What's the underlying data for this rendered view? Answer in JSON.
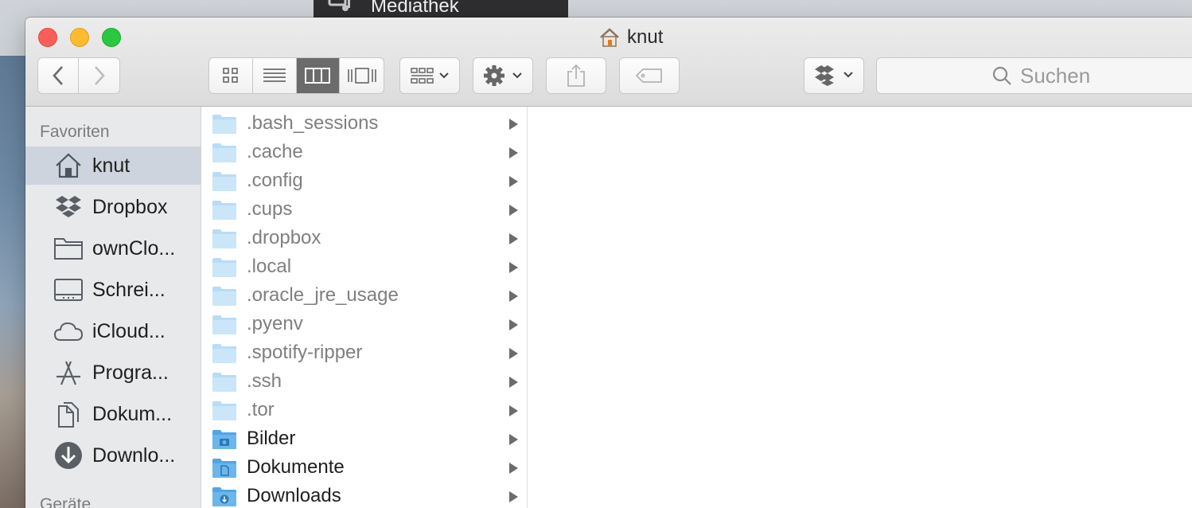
{
  "background_window": {
    "title": "Mediathek"
  },
  "window": {
    "title": "knut"
  },
  "toolbar": {
    "back_icon": "chevron-left-icon",
    "forward_icon": "chevron-right-icon",
    "view_modes": [
      "icon-view",
      "list-view",
      "column-view",
      "cover-flow-view"
    ],
    "active_view": "column-view",
    "search_placeholder": "Suchen"
  },
  "sidebar": {
    "favorites_heading": "Favoriten",
    "devices_heading": "Geräte",
    "items": [
      {
        "label": "knut",
        "icon": "home-icon",
        "selected": true
      },
      {
        "label": "Dropbox",
        "icon": "dropbox-icon"
      },
      {
        "label": "ownClo...",
        "icon": "folder-icon"
      },
      {
        "label": "Schrei...",
        "icon": "desktop-icon"
      },
      {
        "label": "iCloud...",
        "icon": "cloud-icon"
      },
      {
        "label": "Progra...",
        "icon": "applications-icon"
      },
      {
        "label": "Dokum...",
        "icon": "documents-icon"
      },
      {
        "label": "Downlo...",
        "icon": "downloads-icon"
      }
    ]
  },
  "files": [
    {
      "name": ".bash_sessions",
      "hidden": true
    },
    {
      "name": ".cache",
      "hidden": true
    },
    {
      "name": ".config",
      "hidden": true
    },
    {
      "name": ".cups",
      "hidden": true
    },
    {
      "name": ".dropbox",
      "hidden": true
    },
    {
      "name": ".local",
      "hidden": true
    },
    {
      "name": ".oracle_jre_usage",
      "hidden": true
    },
    {
      "name": ".pyenv",
      "hidden": true
    },
    {
      "name": ".spotify-ripper",
      "hidden": true
    },
    {
      "name": ".ssh",
      "hidden": true
    },
    {
      "name": ".tor",
      "hidden": true
    },
    {
      "name": "Bilder",
      "hidden": false,
      "badge": "camera"
    },
    {
      "name": "Dokumente",
      "hidden": false,
      "badge": "document"
    },
    {
      "name": "Downloads",
      "hidden": false,
      "badge": "download"
    }
  ],
  "colors": {
    "folder_light": "#b9dcf5",
    "folder_blue": "#6bb6ea",
    "selection": "#cdd4dd"
  }
}
